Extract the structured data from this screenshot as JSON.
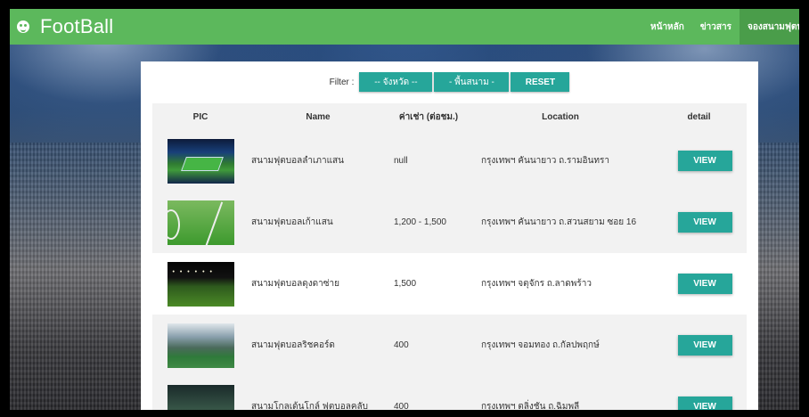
{
  "navbar": {
    "brand": "FootBall",
    "links": [
      "หน้าหลัก",
      "ข่าวสาร",
      "จองสนามฟุตบอล"
    ]
  },
  "filter": {
    "label": "Filter :",
    "province": "-- จังหวัด --",
    "area": "- พื้นสนาม -",
    "reset": "RESET"
  },
  "table": {
    "headers": {
      "pic": "PIC",
      "name": "Name",
      "price": "ค่าเช่า (ต่อชม.)",
      "location": "Location",
      "detail": "detail"
    },
    "rows": [
      {
        "name": "สนามฟุตบอลลำเภาแสน",
        "price": "null",
        "location": "กรุงเทพฯ คันนายาว ถ.รามอินทรา",
        "action": "VIEW"
      },
      {
        "name": "สนามฟุตบอลเก้าแสน",
        "price": "1,200 - 1,500",
        "location": "กรุงเทพฯ คันนายาว ถ.สวนสยาม ซอย 16",
        "action": "VIEW"
      },
      {
        "name": "สนามฟุตบอลดุงดาซ่าย",
        "price": "1,500",
        "location": "กรุงเทพฯ จตุจักร ถ.ลาดพร้าว",
        "action": "VIEW"
      },
      {
        "name": "สนามฟุตบอลริชคอร์ด",
        "price": "400",
        "location": "กรุงเทพฯ จอมทอง ถ.กัลปพฤกษ์",
        "action": "VIEW"
      },
      {
        "name": "สนามโกลเด้นโกล์ ฟุตบอลคลับ",
        "price": "400",
        "location": "กรุงเทพฯ ตลิ่งชัน ถ.ฉิมพลี",
        "action": "VIEW"
      }
    ]
  }
}
